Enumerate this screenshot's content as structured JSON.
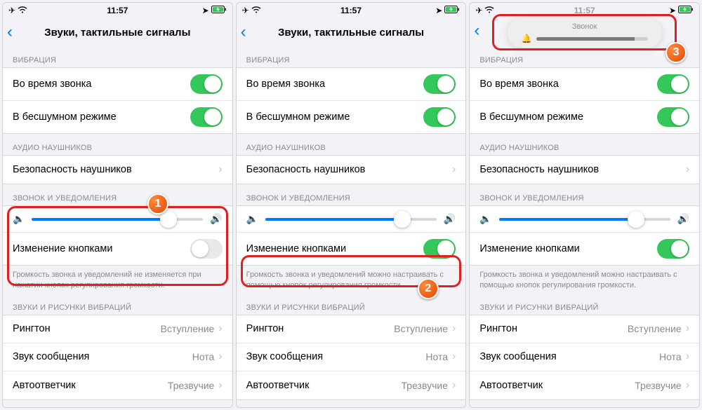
{
  "status": {
    "time": "11:57"
  },
  "nav": {
    "title": "Звуки, тактильные сигналы"
  },
  "sections": {
    "vibration": {
      "header": "ВИБРАЦИЯ",
      "during_call": "Во время звонка",
      "silent_mode": "В бесшумном режиме"
    },
    "headphones": {
      "header": "АУДИО НАУШНИКОВ",
      "safety": "Безопасность наушников"
    },
    "ringer": {
      "header": "ЗВОНОК И УВЕДОМЛЕНИЯ",
      "change_with_buttons": "Изменение кнопками",
      "footer_off": "Громкость звонка и уведомлений не изменяется при нажатии кнопок регулирования громкости.",
      "footer_on": "Громкость звонка и уведомлений можно настраивать с помощью кнопок регулирования громкости."
    },
    "sounds": {
      "header": "ЗВУКИ И РИСУНКИ ВИБРАЦИЙ",
      "ringtone": "Рингтон",
      "ringtone_value": "Вступление",
      "text_tone": "Звук сообщения",
      "text_tone_value": "Нота",
      "voicemail": "Автоответчик",
      "voicemail_value": "Трезвучие"
    }
  },
  "hud": {
    "title": "Звонок"
  },
  "badges": {
    "one": "1",
    "two": "2",
    "three": "3"
  },
  "screens": [
    {
      "change_buttons_on": false,
      "slider_pct": 80,
      "footer_key": "footer_off"
    },
    {
      "change_buttons_on": true,
      "slider_pct": 80,
      "footer_key": "footer_on"
    },
    {
      "change_buttons_on": true,
      "slider_pct": 80,
      "footer_key": "footer_on",
      "hud": true
    }
  ]
}
